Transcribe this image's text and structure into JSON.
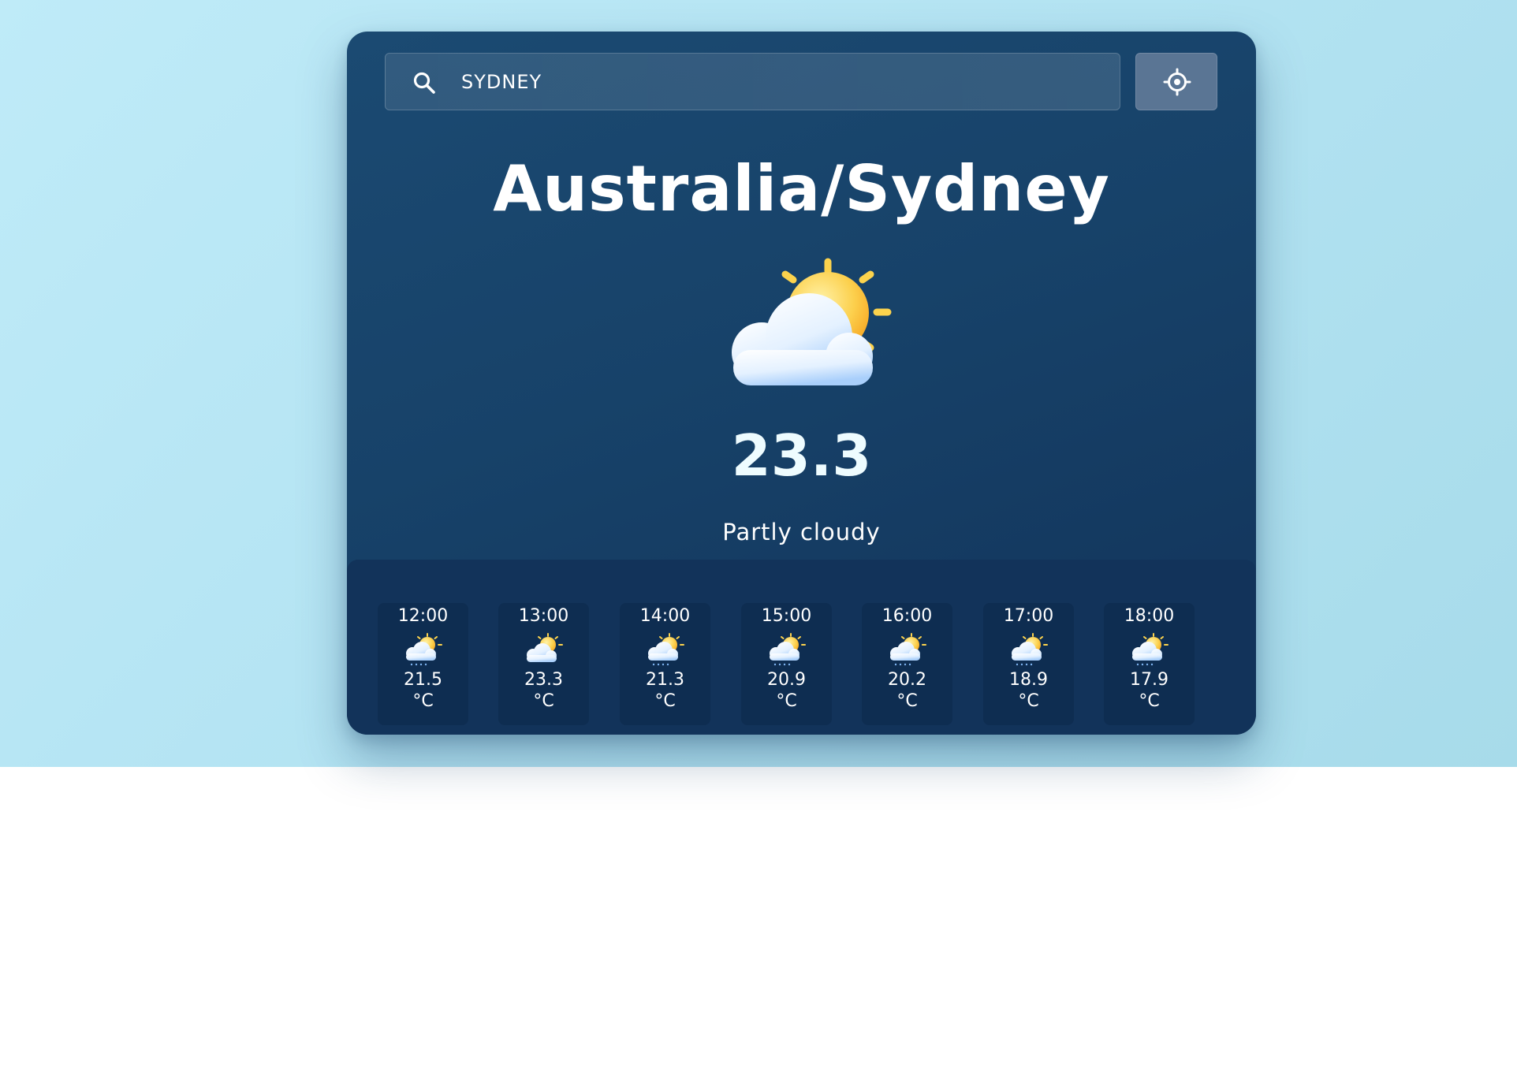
{
  "search": {
    "value": "SYDNEY",
    "icon": "search-icon"
  },
  "locate_button": {
    "icon": "location-target-icon"
  },
  "current": {
    "location": "Australia/Sydney",
    "temperature": "23.3",
    "condition": "Partly cloudy",
    "icon": "partly-cloudy-icon"
  },
  "hourly": [
    {
      "time": "12:00",
      "temp": "21.5",
      "unit": "°C",
      "icon": "partly-cloudy-rain-icon"
    },
    {
      "time": "13:00",
      "temp": "23.3",
      "unit": "°C",
      "icon": "partly-cloudy-icon"
    },
    {
      "time": "14:00",
      "temp": "21.3",
      "unit": "°C",
      "icon": "partly-cloudy-rain-icon"
    },
    {
      "time": "15:00",
      "temp": "20.9",
      "unit": "°C",
      "icon": "partly-cloudy-rain-icon"
    },
    {
      "time": "16:00",
      "temp": "20.2",
      "unit": "°C",
      "icon": "partly-cloudy-rain-icon"
    },
    {
      "time": "17:00",
      "temp": "18.9",
      "unit": "°C",
      "icon": "partly-cloudy-rain-icon"
    },
    {
      "time": "18:00",
      "temp": "17.9",
      "unit": "°C",
      "icon": "partly-cloudy-rain-icon"
    }
  ],
  "colors": {
    "background_light": "#bfebf8",
    "card_top": "#1b4a72",
    "card_bottom": "#12335a",
    "sun": "#fbc02d",
    "cloud": "#e6f3ff"
  }
}
